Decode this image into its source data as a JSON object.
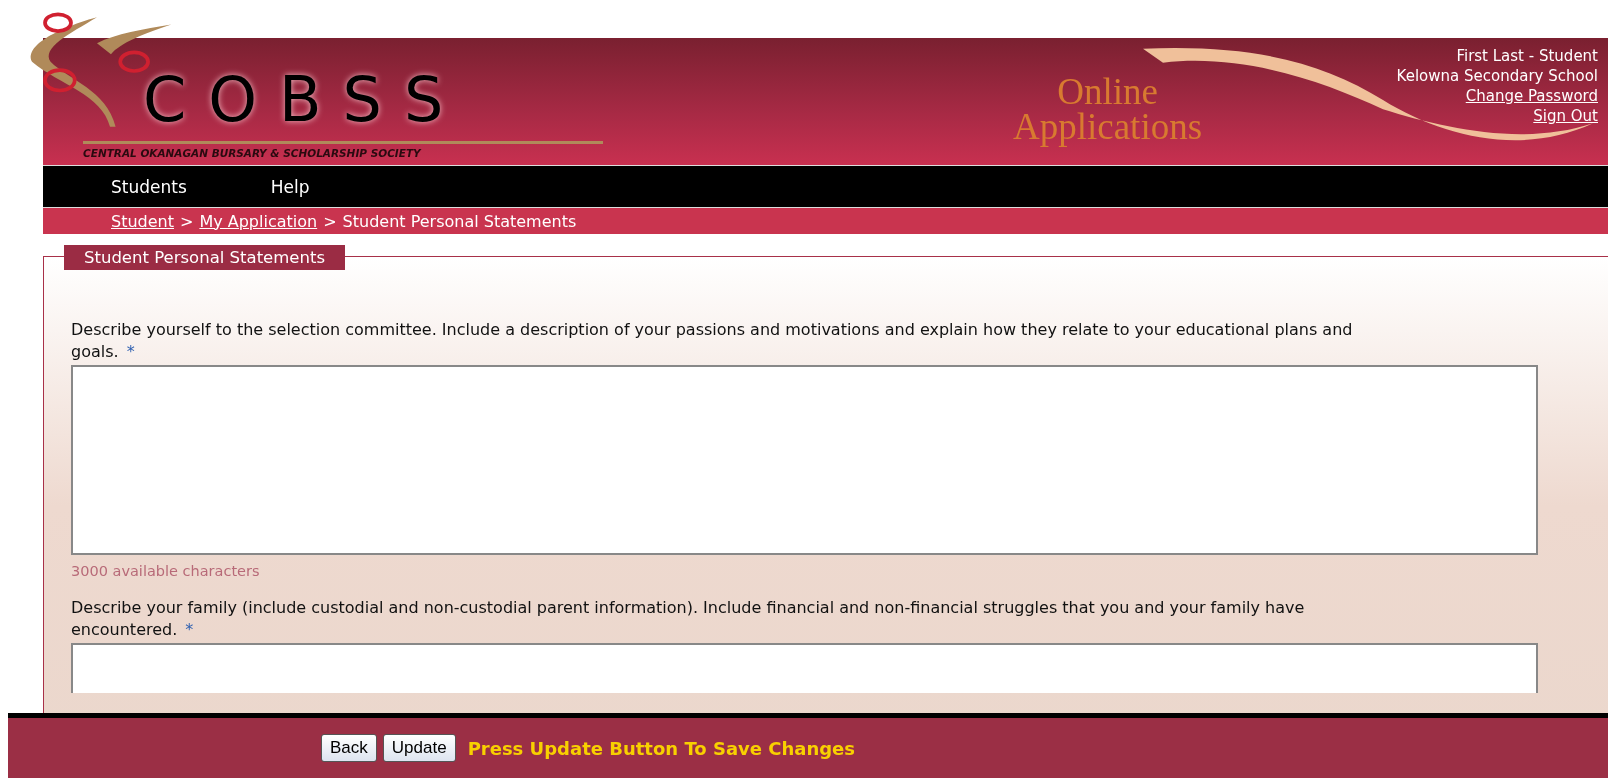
{
  "header": {
    "logo": "COBSS",
    "logo_subtitle": "CENTRAL OKANAGAN BURSARY & SCHOLARSHIP SOCIETY",
    "banner_title": [
      "Online",
      "Applications"
    ],
    "user_name": "First Last - Student",
    "school": "Kelowna Secondary School",
    "links": [
      "Change Password",
      "Sign Out"
    ]
  },
  "nav": {
    "items": [
      "Students",
      "Help"
    ]
  },
  "breadcrumb": {
    "links": [
      "Student",
      "My Application"
    ],
    "separator": ">",
    "current": "Student Personal Statements"
  },
  "section": {
    "legend": "Student Personal Statements",
    "questions": [
      {
        "label": "Describe yourself to the selection committee. Include a description of your passions and motivations and explain how they relate to your educational plans and goals.",
        "required_mark": "*",
        "counter": "3000 available characters"
      },
      {
        "label": "Describe your family (include custodial and non-custodial parent information). Include financial and non-financial struggles that you and your family have encountered.",
        "required_mark": "*"
      }
    ]
  },
  "footer": {
    "buttons": [
      "Back",
      "Update"
    ],
    "message": "Press Update Button To Save Changes"
  }
}
